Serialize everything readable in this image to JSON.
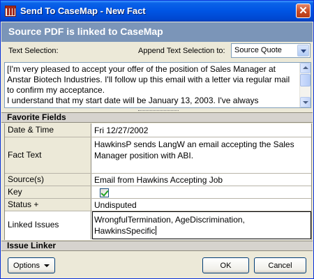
{
  "window": {
    "title": "Send To CaseMap - New Fact",
    "close_glyph": "✕",
    "app_icon": "casemap-building-icon"
  },
  "banner": {
    "text": "Source PDF is linked to CaseMap"
  },
  "selection": {
    "text_selection_label": "Text Selection:",
    "append_label": "Append Text Selection to:",
    "append_value": "Source Quote",
    "text": "[I'm very pleased to accept your offer of the position of Sales Manager at Anstar Biotech Industries. I'll follow up this email with a letter via regular mail to confirm my acceptance.\nI understand that my start date will be January 13, 2003. I've always"
  },
  "favorite_fields": {
    "header": "Favorite Fields",
    "rows": [
      {
        "label": "Date & Time",
        "value": "Fri 12/27/2002"
      },
      {
        "label": "Fact Text",
        "value": "HawkinsP sends LangW an email accepting the Sales Manager position with ABI."
      },
      {
        "label": "Source(s)",
        "value": "Email from Hawkins Accepting Job"
      },
      {
        "label": "Key",
        "checked": true
      },
      {
        "label": "Status +",
        "value": "Undisputed"
      },
      {
        "label": "Linked Issues",
        "value": "WrongfulTermination, AgeDiscrimination, HawkinsSpecific"
      }
    ]
  },
  "issue_linker": {
    "header": "Issue Linker"
  },
  "buttons": {
    "options": "Options",
    "ok": "OK",
    "cancel": "Cancel"
  },
  "colors": {
    "titlebar": "#0054e3",
    "banner": "#7b95b8",
    "dialog_bg": "#ece9d8",
    "checkmark": "#21a121"
  }
}
